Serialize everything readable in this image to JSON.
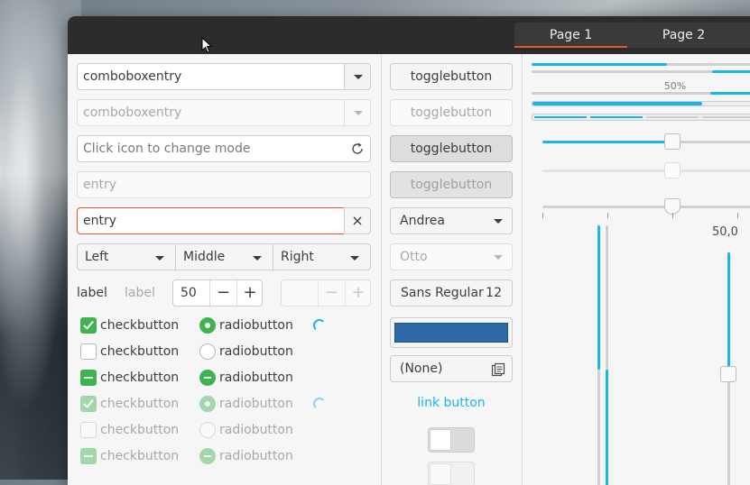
{
  "header": {
    "tabs": [
      {
        "label": "Page 1",
        "active": true
      },
      {
        "label": "Page 2",
        "active": false
      }
    ]
  },
  "left": {
    "combo1": "comboboxentry",
    "combo2": "comboboxentry",
    "icon_entry_placeholder": "Click icon to change mode",
    "entry_disabled_placeholder": "entry",
    "entry_focused_value": "entry",
    "segments": [
      "Left",
      "Middle",
      "Right"
    ],
    "label1": "label",
    "label2": "label",
    "spin_value": "50",
    "check_labels": [
      "checkbutton",
      "checkbutton",
      "checkbutton",
      "checkbutton",
      "checkbutton",
      "checkbutton"
    ],
    "radio_labels": [
      "radiobutton",
      "radiobutton",
      "radiobutton",
      "radiobutton",
      "radiobutton",
      "radiobutton"
    ]
  },
  "middle": {
    "toggle_labels": [
      "togglebutton",
      "togglebutton",
      "togglebutton",
      "togglebutton"
    ],
    "combo_andrea": "Andrea",
    "combo_otto": "Otto",
    "font_name": "Sans Regular",
    "font_size": "12",
    "color_value": "#2e6aa8",
    "file_chooser": "(None)",
    "link": "link button",
    "switch_on": false
  },
  "right": {
    "progress_label": "50%",
    "scale_value_label": "50,0",
    "progress_values": [
      0.6,
      0.5
    ],
    "scale_value": 0.5,
    "accent": "#19b6ee"
  }
}
